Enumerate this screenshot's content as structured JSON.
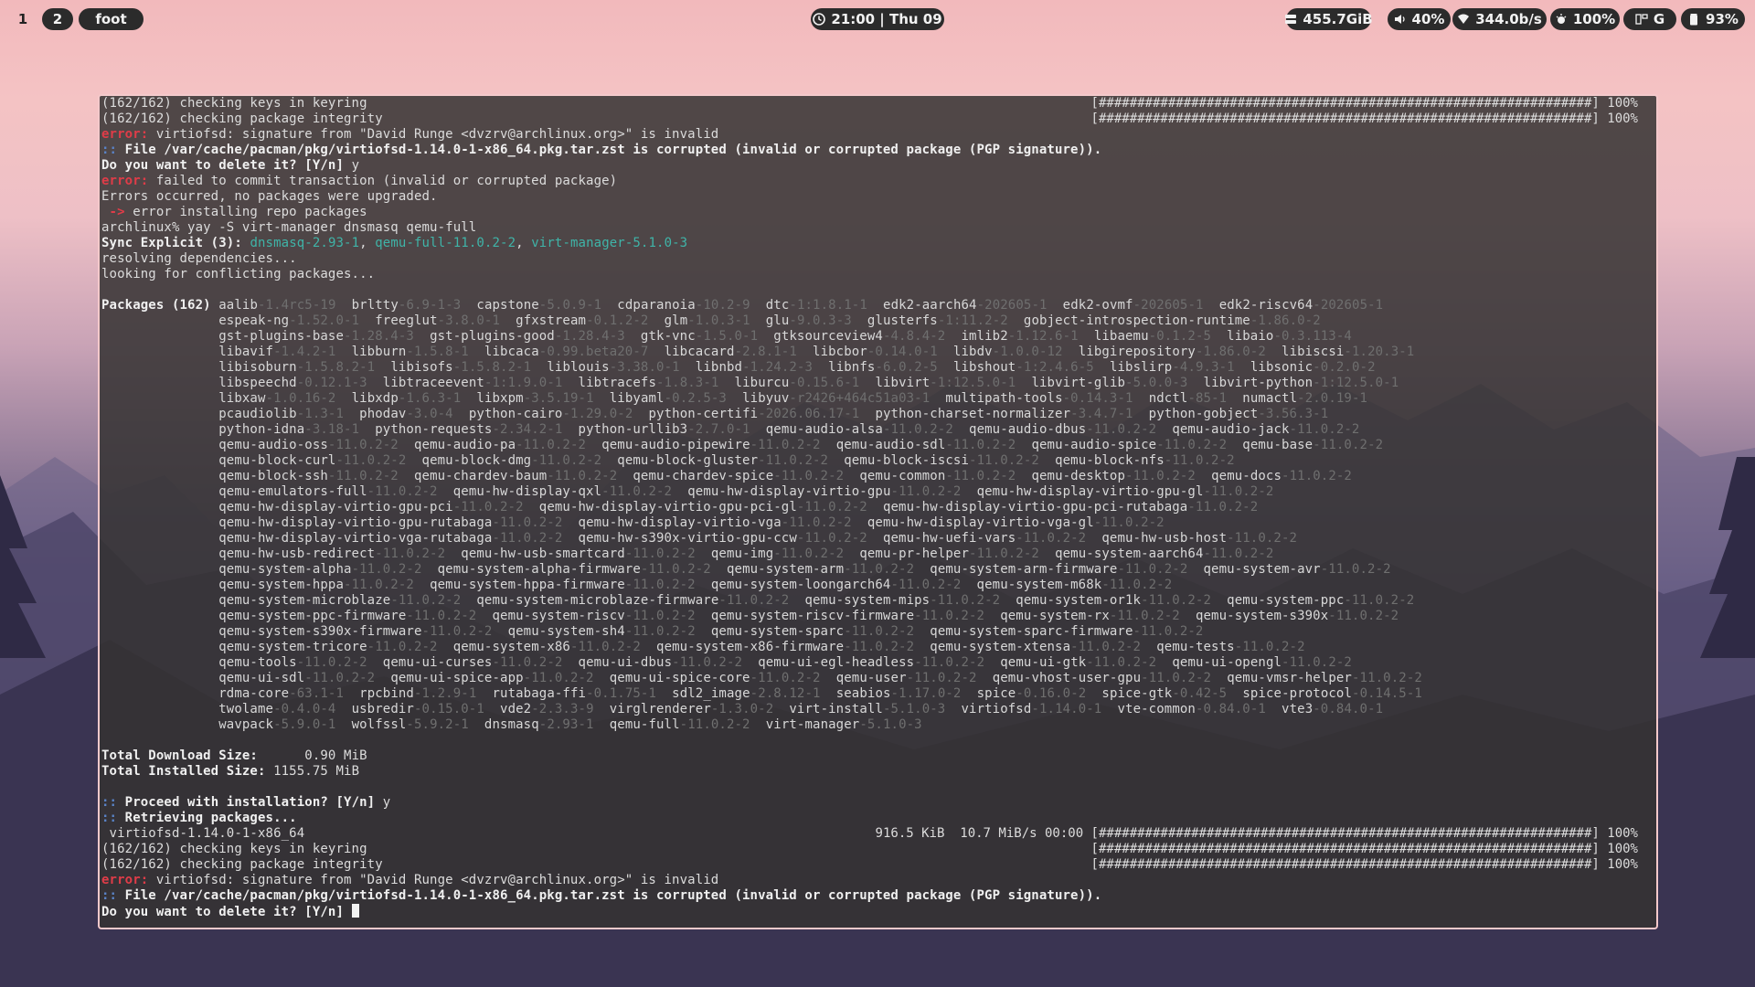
{
  "topbar": {
    "workspace_1": "1",
    "workspace_2": "2",
    "app_name": "foot",
    "clock": "21:00 | Thu 09",
    "disk": "455.7GiB",
    "volume": "40%",
    "network": "344.0b/s",
    "brightness": "100%",
    "keyboard": "G",
    "battery": "93%"
  },
  "terminal": {
    "top": [
      {
        "t": "(162/162) checking keys in keyring",
        "r": "[################################################################] 100%"
      },
      {
        "t": "(162/162) checking package integrity",
        "r": "[################################################################] 100%"
      }
    ],
    "err_label": "error:",
    "err_text_1": " virtiofsd: signature from \"David Runge <dvzrv@archlinux.org>\" is invalid",
    "file_prefix": "::",
    "file_text": " File /var/cache/pacman/pkg/virtiofsd-1.14.0-1-x86_64.pkg.tar.zst is corrupted (invalid or corrupted package (PGP signature)).",
    "delete_prompt_1": "Do you want to delete it? [Y/n] y",
    "err_text_2": " failed to commit transaction (invalid or corrupted package)",
    "errors_occurred": "Errors occurred, no packages were upgraded.",
    "arrow": " ->",
    "install_err": " error installing repo packages",
    "shell_cmd": "archlinux% yay -S virt-manager dnsmasq qemu-full",
    "sync_label": "Sync Explicit (3):",
    "sync_pkgs": [
      {
        "name": "dnsmasq-2.93-1",
        "sep": ", "
      },
      {
        "name": "qemu-full-11.0.2-2",
        "sep": ", "
      },
      {
        "name": "virt-manager-5.1.0-3",
        "sep": ""
      }
    ],
    "resolving": "resolving dependencies...",
    "conflicts": "looking for conflicting packages...",
    "packages_label": "Packages (162)",
    "package_rows": [
      [
        [
          "aalib",
          "-1.4rc5-19"
        ],
        [
          "brltty",
          "-6.9-1-3"
        ],
        [
          "capstone",
          "-5.0.9-1"
        ],
        [
          "cdparanoia",
          "-10.2-9"
        ],
        [
          "dtc",
          "-1:1.8.1-1"
        ],
        [
          "edk2-aarch64",
          "-202605-1"
        ],
        [
          "edk2-ovmf",
          "-202605-1"
        ],
        [
          "edk2-riscv64",
          "-202605-1"
        ]
      ],
      [
        [
          "espeak-ng",
          "-1.52.0-1"
        ],
        [
          "freeglut",
          "-3.8.0-1"
        ],
        [
          "gfxstream",
          "-0.1.2-2"
        ],
        [
          "glm",
          "-1.0.3-1"
        ],
        [
          "glu",
          "-9.0.3-3"
        ],
        [
          "glusterfs",
          "-1:11.2-2"
        ],
        [
          "gobject-introspection-runtime",
          "-1.86.0-2"
        ]
      ],
      [
        [
          "gst-plugins-base",
          "-1.28.4-3"
        ],
        [
          "gst-plugins-good",
          "-1.28.4-3"
        ],
        [
          "gtk-vnc",
          "-1.5.0-1"
        ],
        [
          "gtksourceview4",
          "-4.8.4-2"
        ],
        [
          "imlib2",
          "-1.12.6-1"
        ],
        [
          "libaemu",
          "-0.1.2-5"
        ],
        [
          "libaio",
          "-0.3.113-4"
        ]
      ],
      [
        [
          "libavif",
          "-1.4.2-1"
        ],
        [
          "libburn",
          "-1.5.8-1"
        ],
        [
          "libcaca",
          "-0.99.beta20-7"
        ],
        [
          "libcacard",
          "-2.8.1-1"
        ],
        [
          "libcbor",
          "-0.14.0-1"
        ],
        [
          "libdv",
          "-1.0.0-12"
        ],
        [
          "libgirepository",
          "-1.86.0-2"
        ],
        [
          "libiscsi",
          "-1.20.3-1"
        ]
      ],
      [
        [
          "libisoburn",
          "-1.5.8.2-1"
        ],
        [
          "libisofs",
          "-1.5.8.2-1"
        ],
        [
          "liblouis",
          "-3.38.0-1"
        ],
        [
          "libnbd",
          "-1.24.2-3"
        ],
        [
          "libnfs",
          "-6.0.2-5"
        ],
        [
          "libshout",
          "-1:2.4.6-5"
        ],
        [
          "libslirp",
          "-4.9.3-1"
        ],
        [
          "libsonic",
          "-0.2.0-2"
        ]
      ],
      [
        [
          "libspeechd",
          "-0.12.1-3"
        ],
        [
          "libtraceevent",
          "-1:1.9.0-1"
        ],
        [
          "libtracefs",
          "-1.8.3-1"
        ],
        [
          "liburcu",
          "-0.15.6-1"
        ],
        [
          "libvirt",
          "-1:12.5.0-1"
        ],
        [
          "libvirt-glib",
          "-5.0.0-3"
        ],
        [
          "libvirt-python",
          "-1:12.5.0-1"
        ]
      ],
      [
        [
          "libxaw",
          "-1.0.16-2"
        ],
        [
          "libxdp",
          "-1.6.3-1"
        ],
        [
          "libxpm",
          "-3.5.19-1"
        ],
        [
          "libyaml",
          "-0.2.5-3"
        ],
        [
          "libyuv",
          "-r2426+464c51a03-1"
        ],
        [
          "multipath-tools",
          "-0.14.3-1"
        ],
        [
          "ndctl",
          "-85-1"
        ],
        [
          "numactl",
          "-2.0.19-1"
        ]
      ],
      [
        [
          "pcaudiolib",
          "-1.3-1"
        ],
        [
          "phodav",
          "-3.0-4"
        ],
        [
          "python-cairo",
          "-1.29.0-2"
        ],
        [
          "python-certifi",
          "-2026.06.17-1"
        ],
        [
          "python-charset-normalizer",
          "-3.4.7-1"
        ],
        [
          "python-gobject",
          "-3.56.3-1"
        ]
      ],
      [
        [
          "python-idna",
          "-3.18-1"
        ],
        [
          "python-requests",
          "-2.34.2-1"
        ],
        [
          "python-urllib3",
          "-2.7.0-1"
        ],
        [
          "qemu-audio-alsa",
          "-11.0.2-2"
        ],
        [
          "qemu-audio-dbus",
          "-11.0.2-2"
        ],
        [
          "qemu-audio-jack",
          "-11.0.2-2"
        ]
      ],
      [
        [
          "qemu-audio-oss",
          "-11.0.2-2"
        ],
        [
          "qemu-audio-pa",
          "-11.0.2-2"
        ],
        [
          "qemu-audio-pipewire",
          "-11.0.2-2"
        ],
        [
          "qemu-audio-sdl",
          "-11.0.2-2"
        ],
        [
          "qemu-audio-spice",
          "-11.0.2-2"
        ],
        [
          "qemu-base",
          "-11.0.2-2"
        ]
      ],
      [
        [
          "qemu-block-curl",
          "-11.0.2-2"
        ],
        [
          "qemu-block-dmg",
          "-11.0.2-2"
        ],
        [
          "qemu-block-gluster",
          "-11.0.2-2"
        ],
        [
          "qemu-block-iscsi",
          "-11.0.2-2"
        ],
        [
          "qemu-block-nfs",
          "-11.0.2-2"
        ]
      ],
      [
        [
          "qemu-block-ssh",
          "-11.0.2-2"
        ],
        [
          "qemu-chardev-baum",
          "-11.0.2-2"
        ],
        [
          "qemu-chardev-spice",
          "-11.0.2-2"
        ],
        [
          "qemu-common",
          "-11.0.2-2"
        ],
        [
          "qemu-desktop",
          "-11.0.2-2"
        ],
        [
          "qemu-docs",
          "-11.0.2-2"
        ]
      ],
      [
        [
          "qemu-emulators-full",
          "-11.0.2-2"
        ],
        [
          "qemu-hw-display-qxl",
          "-11.0.2-2"
        ],
        [
          "qemu-hw-display-virtio-gpu",
          "-11.0.2-2"
        ],
        [
          "qemu-hw-display-virtio-gpu-gl",
          "-11.0.2-2"
        ]
      ],
      [
        [
          "qemu-hw-display-virtio-gpu-pci",
          "-11.0.2-2"
        ],
        [
          "qemu-hw-display-virtio-gpu-pci-gl",
          "-11.0.2-2"
        ],
        [
          "qemu-hw-display-virtio-gpu-pci-rutabaga",
          "-11.0.2-2"
        ]
      ],
      [
        [
          "qemu-hw-display-virtio-gpu-rutabaga",
          "-11.0.2-2"
        ],
        [
          "qemu-hw-display-virtio-vga",
          "-11.0.2-2"
        ],
        [
          "qemu-hw-display-virtio-vga-gl",
          "-11.0.2-2"
        ]
      ],
      [
        [
          "qemu-hw-display-virtio-vga-rutabaga",
          "-11.0.2-2"
        ],
        [
          "qemu-hw-s390x-virtio-gpu-ccw",
          "-11.0.2-2"
        ],
        [
          "qemu-hw-uefi-vars",
          "-11.0.2-2"
        ],
        [
          "qemu-hw-usb-host",
          "-11.0.2-2"
        ]
      ],
      [
        [
          "qemu-hw-usb-redirect",
          "-11.0.2-2"
        ],
        [
          "qemu-hw-usb-smartcard",
          "-11.0.2-2"
        ],
        [
          "qemu-img",
          "-11.0.2-2"
        ],
        [
          "qemu-pr-helper",
          "-11.0.2-2"
        ],
        [
          "qemu-system-aarch64",
          "-11.0.2-2"
        ]
      ],
      [
        [
          "qemu-system-alpha",
          "-11.0.2-2"
        ],
        [
          "qemu-system-alpha-firmware",
          "-11.0.2-2"
        ],
        [
          "qemu-system-arm",
          "-11.0.2-2"
        ],
        [
          "qemu-system-arm-firmware",
          "-11.0.2-2"
        ],
        [
          "qemu-system-avr",
          "-11.0.2-2"
        ]
      ],
      [
        [
          "qemu-system-hppa",
          "-11.0.2-2"
        ],
        [
          "qemu-system-hppa-firmware",
          "-11.0.2-2"
        ],
        [
          "qemu-system-loongarch64",
          "-11.0.2-2"
        ],
        [
          "qemu-system-m68k",
          "-11.0.2-2"
        ]
      ],
      [
        [
          "qemu-system-microblaze",
          "-11.0.2-2"
        ],
        [
          "qemu-system-microblaze-firmware",
          "-11.0.2-2"
        ],
        [
          "qemu-system-mips",
          "-11.0.2-2"
        ],
        [
          "qemu-system-or1k",
          "-11.0.2-2"
        ],
        [
          "qemu-system-ppc",
          "-11.0.2-2"
        ]
      ],
      [
        [
          "qemu-system-ppc-firmware",
          "-11.0.2-2"
        ],
        [
          "qemu-system-riscv",
          "-11.0.2-2"
        ],
        [
          "qemu-system-riscv-firmware",
          "-11.0.2-2"
        ],
        [
          "qemu-system-rx",
          "-11.0.2-2"
        ],
        [
          "qemu-system-s390x",
          "-11.0.2-2"
        ]
      ],
      [
        [
          "qemu-system-s390x-firmware",
          "-11.0.2-2"
        ],
        [
          "qemu-system-sh4",
          "-11.0.2-2"
        ],
        [
          "qemu-system-sparc",
          "-11.0.2-2"
        ],
        [
          "qemu-system-sparc-firmware",
          "-11.0.2-2"
        ]
      ],
      [
        [
          "qemu-system-tricore",
          "-11.0.2-2"
        ],
        [
          "qemu-system-x86",
          "-11.0.2-2"
        ],
        [
          "qemu-system-x86-firmware",
          "-11.0.2-2"
        ],
        [
          "qemu-system-xtensa",
          "-11.0.2-2"
        ],
        [
          "qemu-tests",
          "-11.0.2-2"
        ]
      ],
      [
        [
          "qemu-tools",
          "-11.0.2-2"
        ],
        [
          "qemu-ui-curses",
          "-11.0.2-2"
        ],
        [
          "qemu-ui-dbus",
          "-11.0.2-2"
        ],
        [
          "qemu-ui-egl-headless",
          "-11.0.2-2"
        ],
        [
          "qemu-ui-gtk",
          "-11.0.2-2"
        ],
        [
          "qemu-ui-opengl",
          "-11.0.2-2"
        ]
      ],
      [
        [
          "qemu-ui-sdl",
          "-11.0.2-2"
        ],
        [
          "qemu-ui-spice-app",
          "-11.0.2-2"
        ],
        [
          "qemu-ui-spice-core",
          "-11.0.2-2"
        ],
        [
          "qemu-user",
          "-11.0.2-2"
        ],
        [
          "qemu-vhost-user-gpu",
          "-11.0.2-2"
        ],
        [
          "qemu-vmsr-helper",
          "-11.0.2-2"
        ]
      ],
      [
        [
          "rdma-core",
          "-63.1-1"
        ],
        [
          "rpcbind",
          "-1.2.9-1"
        ],
        [
          "rutabaga-ffi",
          "-0.1.75-1"
        ],
        [
          "sdl2_image",
          "-2.8.12-1"
        ],
        [
          "seabios",
          "-1.17.0-2"
        ],
        [
          "spice",
          "-0.16.0-2"
        ],
        [
          "spice-gtk",
          "-0.42-5"
        ],
        [
          "spice-protocol",
          "-0.14.5-1"
        ]
      ],
      [
        [
          "twolame",
          "-0.4.0-4"
        ],
        [
          "usbredir",
          "-0.15.0-1"
        ],
        [
          "vde2",
          "-2.3.3-9"
        ],
        [
          "virglrenderer",
          "-1.3.0-2"
        ],
        [
          "virt-install",
          "-5.1.0-3"
        ],
        [
          "virtiofsd",
          "-1.14.0-1"
        ],
        [
          "vte-common",
          "-0.84.0-1"
        ],
        [
          "vte3",
          "-0.84.0-1"
        ]
      ],
      [
        [
          "wavpack",
          "-5.9.0-1"
        ],
        [
          "wolfssl",
          "-5.9.2-1"
        ],
        [
          "dnsmasq",
          "-2.93-1"
        ],
        [
          "qemu-full",
          "-11.0.2-2"
        ],
        [
          "virt-manager",
          "-5.1.0-3"
        ]
      ]
    ],
    "total_download_label": "Total Download Size:",
    "total_download_value": "0.90 MiB",
    "total_installed_label": "Total Installed Size:",
    "total_installed_value": "1155.75 MiB",
    "proceed": " Proceed with installation? [Y/n]",
    "proceed_answer": " y",
    "retrieving": " Retrieving packages...",
    "download_pkg": " virtiofsd-1.14.0-1-x86_64",
    "download_stats": "916.5 KiB  10.7 MiB/s 00:00 [################################################################] 100%",
    "bottom": [
      {
        "t": "(162/162) checking keys in keyring",
        "r": "[################################################################] 100%"
      },
      {
        "t": "(162/162) checking package integrity",
        "r": "[################################################################] 100%"
      }
    ],
    "delete_prompt_2": "Do you want to delete it? [Y/n] "
  }
}
